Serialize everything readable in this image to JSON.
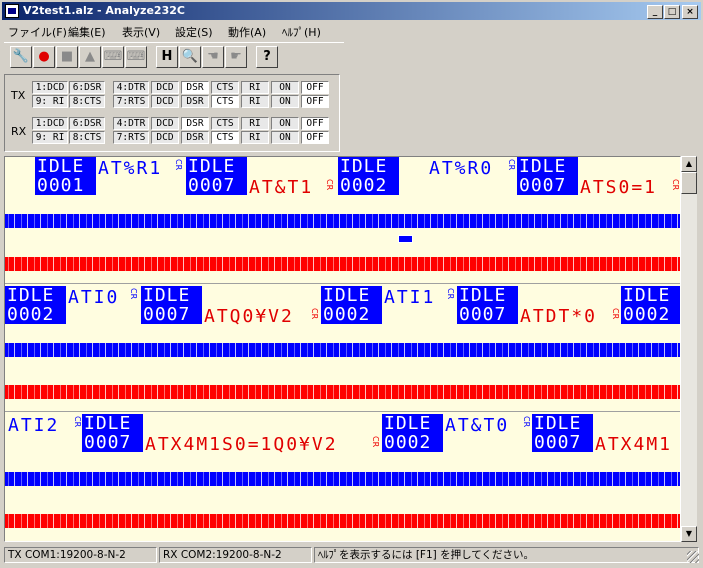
{
  "window": {
    "title": "V2test1.alz - Analyze232C",
    "minimize": "_",
    "maximize": "□",
    "close": "×"
  },
  "menu": [
    "ファイル(F)",
    "編集(E)",
    "表示(V)",
    "設定(S)",
    "動作(A)",
    "ﾍﾙﾌﾟ(H)"
  ],
  "toolbar": {
    "wrench": "🔧",
    "record": "●",
    "stop": "■",
    "up": "▲",
    "kbd1": "⌨",
    "kbd2": "⌨",
    "h": "H",
    "search": "🔍",
    "hand1": "☚",
    "hand2": "☛",
    "help": "?"
  },
  "signals": {
    "tx_label": "TX",
    "rx_label": "RX",
    "pins_a": [
      "1:DCD",
      "6:DSR",
      "9: RI",
      "8:CTS"
    ],
    "pins_b": [
      "4:DTR",
      "7:RTS"
    ],
    "lines": [
      "DCD",
      "DSR",
      "CTS",
      "RI",
      "ON",
      "OFF"
    ]
  },
  "trace": {
    "row1": {
      "b1_top": "IDLE",
      "b1_bot": "0001",
      "t1": "AT%R1",
      "b2_top": "IDLE",
      "b2_bot": "0007",
      "r1": "AT&T1",
      "b3_top": "IDLE",
      "b3_bot": "0002",
      "t2": "AT%R0",
      "b4_top": "IDLE",
      "b4_bot": "0007",
      "r2": "ATS0=1"
    },
    "row2": {
      "b1_top": "IDLE",
      "b1_bot": "0002",
      "t1": "ATI0",
      "b2_top": "IDLE",
      "b2_bot": "0007",
      "r1": "ATQ0¥V2",
      "b3_top": "IDLE",
      "b3_bot": "0002",
      "t2": "ATI1",
      "b4_top": "IDLE",
      "b4_bot": "0007",
      "r2": "ATDT*0",
      "b5_top": "IDLE",
      "b5_bot": "0002"
    },
    "row3": {
      "t1": "ATI2",
      "b1_top": "IDLE",
      "b1_bot": "0007",
      "r1": "ATX4M1S0=1Q0¥V2",
      "b2_top": "IDLE",
      "b2_bot": "0002",
      "t2": "AT&T0",
      "b3_top": "IDLE",
      "b3_bot": "0007",
      "r2": "ATX4M1"
    },
    "cr": "CR"
  },
  "status": {
    "tx": "TX COM1:19200-8-N-2",
    "rx": "RX COM2:19200-8-N-2",
    "help": "ﾍﾙﾌﾟを表示するには [F1] を押してください。"
  }
}
